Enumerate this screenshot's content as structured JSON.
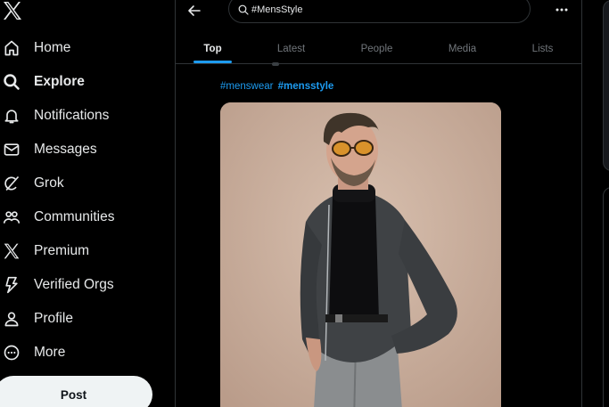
{
  "sidebar": {
    "logo": "x-logo-icon",
    "items": [
      {
        "label": "Home",
        "icon": "home-icon"
      },
      {
        "label": "Explore",
        "icon": "search-icon"
      },
      {
        "label": "Notifications",
        "icon": "bell-icon"
      },
      {
        "label": "Messages",
        "icon": "envelope-icon"
      },
      {
        "label": "Grok",
        "icon": "grok-icon"
      },
      {
        "label": "Communities",
        "icon": "people-icon"
      },
      {
        "label": "Premium",
        "icon": "x-logo-icon"
      },
      {
        "label": "Verified Orgs",
        "icon": "lightning-icon"
      },
      {
        "label": "Profile",
        "icon": "person-icon"
      },
      {
        "label": "More",
        "icon": "more-circle-icon"
      }
    ],
    "active": "Explore",
    "post_label": "Post"
  },
  "header": {
    "search_value": "#MensStyle"
  },
  "tabs": [
    "Top",
    "Latest",
    "People",
    "Media",
    "Lists"
  ],
  "active_tab": "Top",
  "post": {
    "hashtag_1": "#menswear",
    "hashtag_2": "#mensstyle"
  },
  "colors": {
    "background": "#000000",
    "accent": "#1d9bf0",
    "text": "#e7e9ea",
    "muted": "#71767b",
    "border": "#2f3336"
  }
}
